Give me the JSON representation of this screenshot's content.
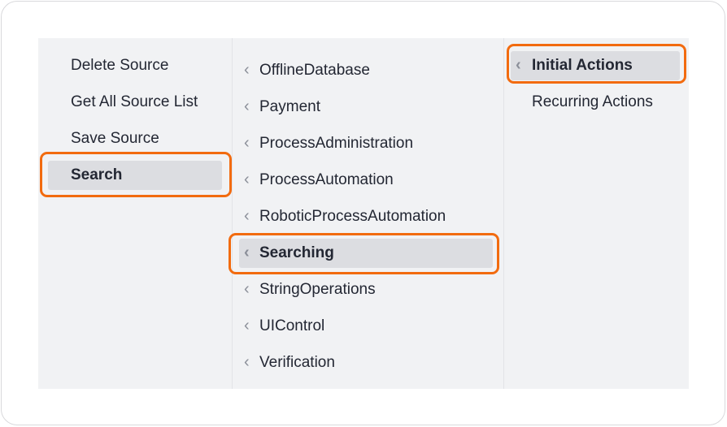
{
  "column1": {
    "items": [
      {
        "label": "Delete Source"
      },
      {
        "label": "Get All Source List"
      },
      {
        "label": "Save Source"
      },
      {
        "label": "Search"
      }
    ]
  },
  "column2": {
    "chevron": "‹",
    "items": [
      {
        "label": "OfflineDatabase"
      },
      {
        "label": "Payment"
      },
      {
        "label": "ProcessAdministration"
      },
      {
        "label": "ProcessAutomation"
      },
      {
        "label": "RoboticProcessAutomation"
      },
      {
        "label": "Searching"
      },
      {
        "label": "StringOperations"
      },
      {
        "label": "UIControl"
      },
      {
        "label": "Verification"
      }
    ]
  },
  "column3": {
    "chevron": "‹",
    "items": [
      {
        "label": "Initial Actions"
      },
      {
        "label": "Recurring Actions"
      }
    ]
  },
  "selected": {
    "column1": "Search",
    "column2": "Searching",
    "column3": "Initial Actions"
  },
  "colors": {
    "highlight": "#f26b0f",
    "panel": "#f1f2f4",
    "active_row": "#dcdde1",
    "text": "#232733",
    "chevron": "#8b8f99"
  },
  "icons": {
    "submenu_arrow": "chevron-left-icon"
  }
}
